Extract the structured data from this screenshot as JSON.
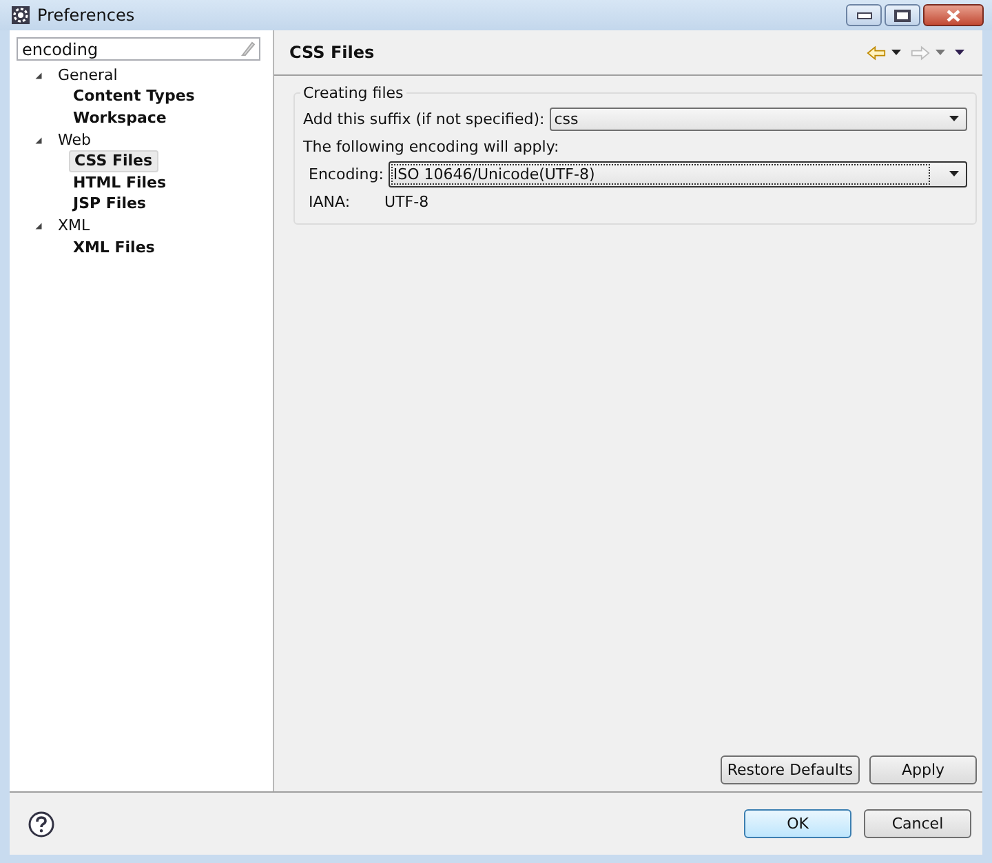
{
  "window": {
    "title": "Preferences"
  },
  "filter": {
    "value": "encoding"
  },
  "tree": [
    {
      "label": "General",
      "expanded": true,
      "selected": false,
      "children": [
        {
          "label": "Content Types",
          "selected": false
        },
        {
          "label": "Workspace",
          "selected": false
        }
      ]
    },
    {
      "label": "Web",
      "expanded": true,
      "selected": false,
      "children": [
        {
          "label": "CSS Files",
          "selected": true
        },
        {
          "label": "HTML Files",
          "selected": false
        },
        {
          "label": "JSP Files",
          "selected": false
        }
      ]
    },
    {
      "label": "XML",
      "expanded": true,
      "selected": false,
      "children": [
        {
          "label": "XML Files",
          "selected": false
        }
      ]
    }
  ],
  "page": {
    "title": "CSS Files",
    "group": {
      "title": "Creating files",
      "suffix_label": "Add this suffix (if not specified):",
      "suffix_value": "css",
      "note": "The following encoding will apply:",
      "encoding_label": "Encoding:",
      "encoding_value": "ISO 10646/Unicode(UTF-8)",
      "iana_label": "IANA:",
      "iana_value": "UTF-8"
    },
    "buttons": [
      "Restore Defaults",
      "Apply"
    ]
  },
  "dialog_buttons": [
    {
      "label": "OK",
      "default": true
    },
    {
      "label": "Cancel",
      "default": false
    }
  ]
}
